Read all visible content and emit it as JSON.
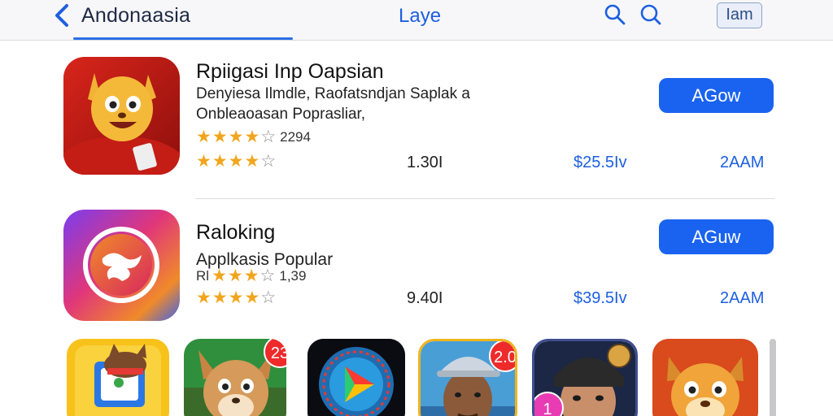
{
  "nav": {
    "back_label": "Andonaasia",
    "title": "Laye",
    "button_label": "Iam"
  },
  "apps": [
    {
      "name": "Rpiigasi Inp Oapsian",
      "subtitle_line1": "Denyiesa Ilmdle, Raofatsndjan Saplak a",
      "subtitle_line2": "Onbleaoasan Poprasliar,",
      "rating_a": {
        "stars": 4,
        "count": "2294"
      },
      "rating_b": {
        "stars": 4
      },
      "size": "1.30I",
      "price": "$25.5Iv",
      "time": "2AAM",
      "button_label": "AGow"
    },
    {
      "name": "Raloking",
      "subtitle_line1": "Applkasis Popular",
      "rating_a": {
        "prefix": "Rl",
        "stars": 3,
        "count": "1,39"
      },
      "rating_b": {
        "stars": 4
      },
      "size": "9.40I",
      "price": "$39.5Iv",
      "time": "2AAM",
      "button_label": "AGuw"
    }
  ],
  "strip": [
    {
      "icon": "folder-mascot-icon"
    },
    {
      "icon": "deer-mascot-icon",
      "badge": "23"
    },
    {
      "icon": "play-compass-icon"
    },
    {
      "icon": "man-portrait-icon",
      "badge": "2.0"
    },
    {
      "icon": "pilot-portrait-icon",
      "badge": "1"
    },
    {
      "icon": "squirrel-mascot-icon"
    }
  ],
  "colors": {
    "accent": "#1a63f0",
    "star": "#f1a51c",
    "badge": "#ee2a2a",
    "nav_bg": "#f7f7f9"
  }
}
